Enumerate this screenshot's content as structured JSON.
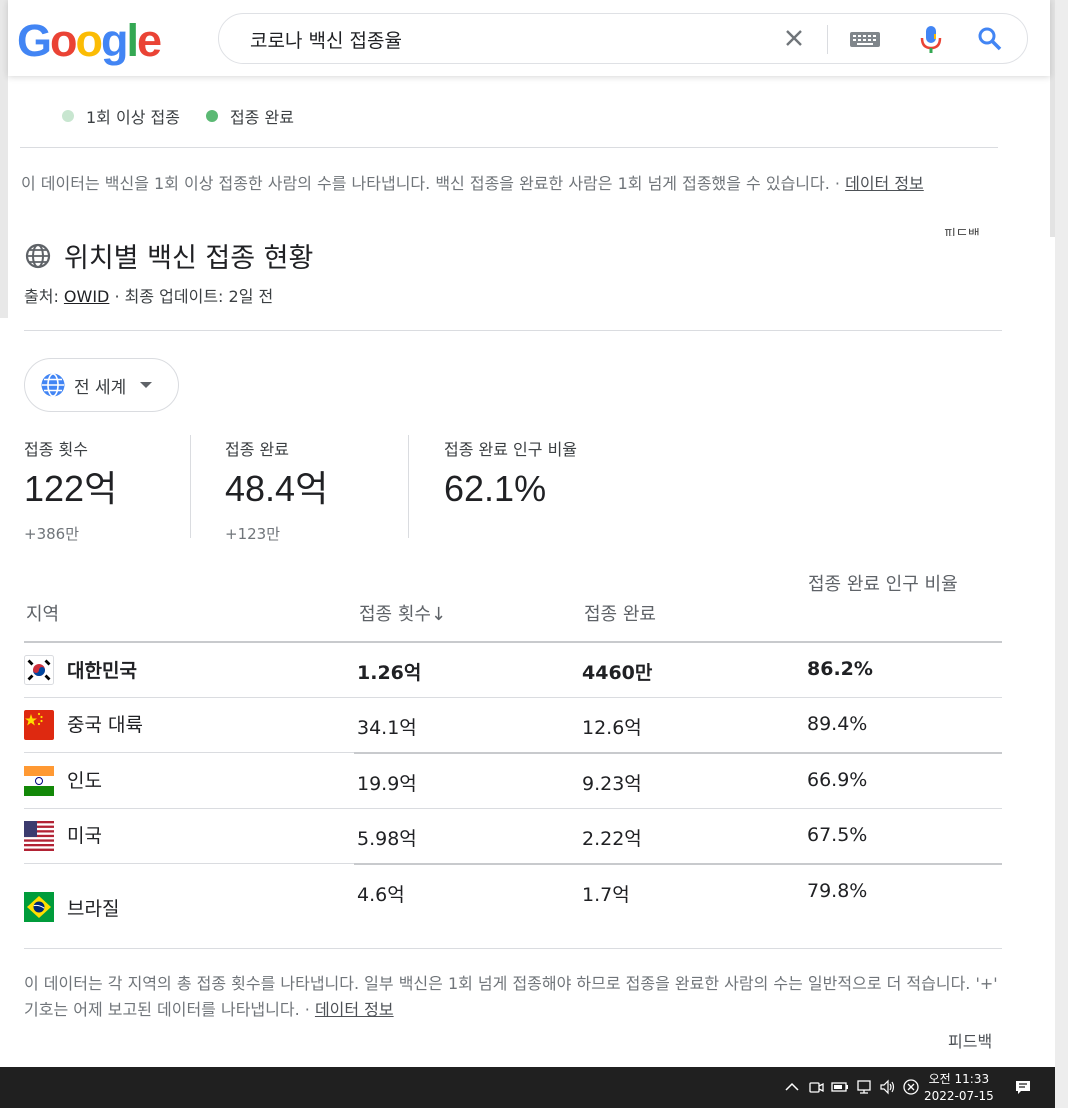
{
  "search": {
    "query": "코로나 백신 접종율"
  },
  "legend": {
    "items": [
      {
        "label": "1회 이상 접종",
        "color": "#c8e6d0"
      },
      {
        "label": "접종 완료",
        "color": "#5bb974"
      }
    ]
  },
  "top_note": {
    "text": "이 데이터는 백신을 1회 이상 접종한 사람의 수를 나타냅니다. 백신 접종을 완료한 사람은 1회 넘게 접종했을 수 있습니다. · ",
    "link": "데이터 정보"
  },
  "feedback_top": "피드백",
  "section": {
    "title": "위치별 백신 접종 현황",
    "source_prefix": "출처: ",
    "source_link": "OWID",
    "source_suffix": " · 최종 업데이트: 2일 전"
  },
  "region_selector": {
    "label": "전 세계"
  },
  "stats": [
    {
      "label": "접종 횟수",
      "value": "122억",
      "delta": "+386만"
    },
    {
      "label": "접종 완료",
      "value": "48.4억",
      "delta": "+123만"
    },
    {
      "label": "접종 완료 인구 비율",
      "value": "62.1%",
      "delta": ""
    }
  ],
  "table": {
    "headers": [
      "지역",
      "접종 횟수↓",
      "접종 완료",
      "접종 완료 인구 비율"
    ],
    "rows": [
      {
        "region": "대한민국",
        "doses": "1.26억",
        "completed": "4460만",
        "percent": "86.2%",
        "flag": "south-korea-flag",
        "bold": true
      },
      {
        "region": "중국 대륙",
        "doses": "34.1억",
        "completed": "12.6억",
        "percent": "89.4%",
        "flag": "china-flag",
        "bold": false
      },
      {
        "region": "인도",
        "doses": "19.9억",
        "completed": "9.23억",
        "percent": "66.9%",
        "flag": "india-flag",
        "bold": false
      },
      {
        "region": "미국",
        "doses": "5.98억",
        "completed": "2.22억",
        "percent": "67.5%",
        "flag": "usa-flag",
        "bold": false
      },
      {
        "region": "브라질",
        "doses": "4.6억",
        "completed": "1.7억",
        "percent": "79.8%",
        "flag": "brazil-flag",
        "bold": false
      }
    ]
  },
  "bottom_note": {
    "text": "이 데이터는 각 지역의 총 접종 횟수를 나타냅니다. 일부 백신은 1회 넘게 접종해야 하므로 접종을 완료한 사람의 수는 일반적으로 더 적습니다. '+' 기호는 어제 보고된 데이터를 나타냅니다. · ",
    "link": "데이터 정보"
  },
  "feedback_bottom": "피드백",
  "taskbar": {
    "time": "오전 11:33",
    "date": "2022-07-15"
  }
}
